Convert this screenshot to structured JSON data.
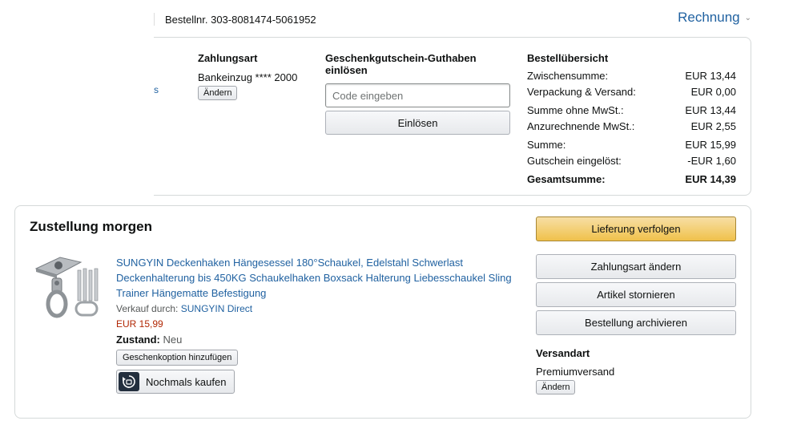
{
  "header": {
    "order_number": "Bestellnr. 303-8081474-5061952",
    "invoice_label": "Rechnung"
  },
  "summary": {
    "cutoff_text": "s",
    "payment": {
      "heading": "Zahlungsart",
      "method": "Bankeinzug **** 2000",
      "change_label": "Ändern"
    },
    "gift_card": {
      "heading": "Geschenkgutschein-Guthaben einlösen",
      "placeholder": "Code eingeben",
      "redeem_label": "Einlösen"
    },
    "overview": {
      "heading": "Bestellübersicht",
      "rows": [
        {
          "label": "Zwischensumme:",
          "value": "EUR 13,44"
        },
        {
          "label": "Verpackung & Versand:",
          "value": "EUR 0,00"
        },
        {
          "label": "Summe ohne MwSt.:",
          "value": "EUR 13,44"
        },
        {
          "label": "Anzurechnende MwSt.:",
          "value": "EUR 2,55"
        },
        {
          "label": "Summe:",
          "value": "EUR 15,99"
        },
        {
          "label": "Gutschein eingelöst:",
          "value": "-EUR 1,60"
        },
        {
          "label": "Gesamtsumme:",
          "value": "EUR 14,39"
        }
      ]
    }
  },
  "shipment": {
    "title": "Zustellung morgen",
    "product": {
      "title": "SUNGYIN Deckenhaken Hängesessel 180°Schaukel, Edelstahl Schwerlast Deckenhalterung bis 450KG Schaukelhaken Boxsack Halterung Liebesschaukel Sling Trainer Hängematte Befestigung",
      "sold_by_label": "Verkauf durch:",
      "seller": "SUNGYIN Direct",
      "price": "EUR 15,99",
      "condition_label": "Zustand:",
      "condition_value": "Neu",
      "gift_option_label": "Geschenkoption hinzufügen",
      "buy_again_label": "Nochmals kaufen"
    },
    "actions": {
      "track": "Lieferung verfolgen",
      "change_payment": "Zahlungsart ändern",
      "cancel_items": "Artikel stornieren",
      "archive": "Bestellung archivieren"
    },
    "shipping_method": {
      "heading": "Versandart",
      "value": "Premiumversand",
      "change_label": "Ändern"
    }
  },
  "colors": {
    "link": "#2162a1",
    "price": "#b12704",
    "primary_button": "#f0c14b",
    "border": "#d5d9d9"
  }
}
